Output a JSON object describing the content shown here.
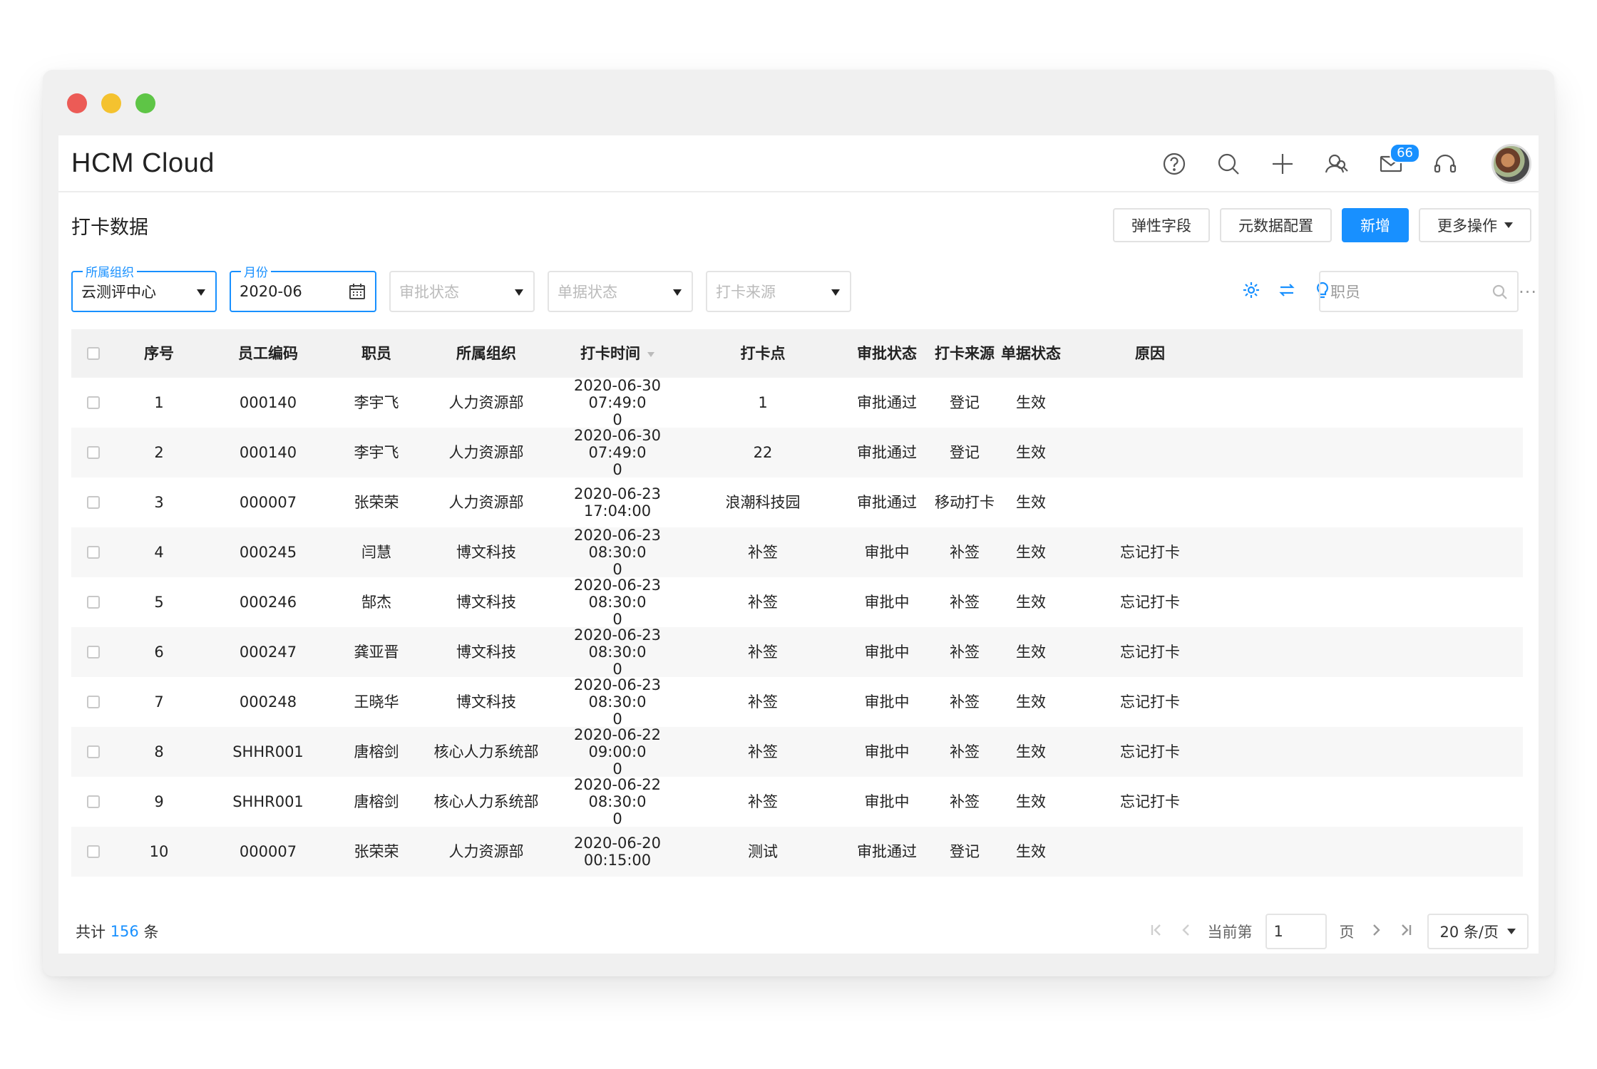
{
  "window": {
    "traffic_colors": [
      "#ec5b56",
      "#f4c22f",
      "#5ec546"
    ]
  },
  "header": {
    "brand": "HCM Cloud",
    "icons": [
      "help-icon",
      "search-icon",
      "plus-icon",
      "people-icon",
      "mail-icon",
      "headset-icon"
    ],
    "mail_badge": "66"
  },
  "page": {
    "title": "打卡数据",
    "actions": {
      "flex_fields": "弹性字段",
      "metadata_config": "元数据配置",
      "add": "新增",
      "more": "更多操作"
    }
  },
  "filters": {
    "org": {
      "label": "所属组织",
      "value": "云测评中心"
    },
    "month": {
      "label": "月份",
      "value": "2020-06"
    },
    "approval_status": {
      "placeholder": "审批状态"
    },
    "doc_status": {
      "placeholder": "单据状态"
    },
    "punch_source": {
      "placeholder": "打卡来源"
    },
    "search": {
      "placeholder": "职员"
    },
    "more": "···"
  },
  "table": {
    "columns": [
      "序号",
      "员工编码",
      "职员",
      "所属组织",
      "打卡时间",
      "打卡点",
      "审批状态",
      "打卡来源",
      "单据状态",
      "原因"
    ],
    "rows": [
      [
        "1",
        "000140",
        "李宇飞",
        "人力资源部",
        "2020-06-30 07:49:0\n0",
        "1",
        "审批通过",
        "登记",
        "生效",
        ""
      ],
      [
        "2",
        "000140",
        "李宇飞",
        "人力资源部",
        "2020-06-30 07:49:0\n0",
        "22",
        "审批通过",
        "登记",
        "生效",
        ""
      ],
      [
        "3",
        "000007",
        "张荣荣",
        "人力资源部",
        "2020-06-23 17:04:00",
        "浪潮科技园",
        "审批通过",
        "移动打卡",
        "生效",
        ""
      ],
      [
        "4",
        "000245",
        "闫慧",
        "博文科技",
        "2020-06-23 08:30:0\n0",
        "补签",
        "审批中",
        "补签",
        "生效",
        "忘记打卡"
      ],
      [
        "5",
        "000246",
        "郜杰",
        "博文科技",
        "2020-06-23 08:30:0\n0",
        "补签",
        "审批中",
        "补签",
        "生效",
        "忘记打卡"
      ],
      [
        "6",
        "000247",
        "龚亚晋",
        "博文科技",
        "2020-06-23 08:30:0\n0",
        "补签",
        "审批中",
        "补签",
        "生效",
        "忘记打卡"
      ],
      [
        "7",
        "000248",
        "王晓华",
        "博文科技",
        "2020-06-23 08:30:0\n0",
        "补签",
        "审批中",
        "补签",
        "生效",
        "忘记打卡"
      ],
      [
        "8",
        "SHHR001",
        "唐榕剑",
        "核心人力系统部",
        "2020-06-22 09:00:0\n0",
        "补签",
        "审批中",
        "补签",
        "生效",
        "忘记打卡"
      ],
      [
        "9",
        "SHHR001",
        "唐榕剑",
        "核心人力系统部",
        "2020-06-22 08:30:0\n0",
        "补签",
        "审批中",
        "补签",
        "生效",
        "忘记打卡"
      ],
      [
        "10",
        "000007",
        "张荣荣",
        "人力资源部",
        "2020-06-20 00:15:00",
        "测试",
        "审批通过",
        "登记",
        "生效",
        ""
      ]
    ]
  },
  "footer": {
    "total_prefix": "共计",
    "total": "156",
    "total_suffix": "条",
    "current_page_prefix": "当前第",
    "current_page": "1",
    "page_suffix": "页",
    "page_size": "20 条/页"
  }
}
